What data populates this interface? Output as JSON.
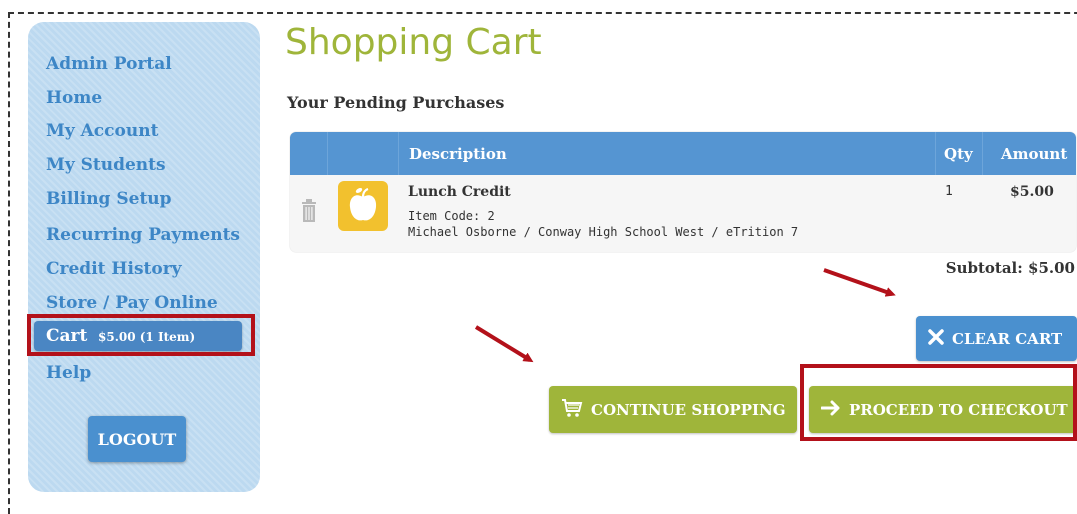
{
  "sidebar": {
    "items": [
      {
        "label": "Admin Portal"
      },
      {
        "label": "Home"
      },
      {
        "label": "My Account"
      },
      {
        "label": "My Students"
      },
      {
        "label": "Billing Setup"
      },
      {
        "label": "Recurring Payments"
      },
      {
        "label": "Credit History"
      },
      {
        "label": "Store / Pay Online"
      },
      {
        "label": "Cart",
        "badge": "$5.00 (1 Item)",
        "active": true
      },
      {
        "label": "Help"
      }
    ],
    "logout_label": "LOGOUT"
  },
  "main": {
    "title": "Shopping Cart",
    "subtitle": "Your Pending Purchases",
    "table": {
      "headers": {
        "description": "Description",
        "qty": "Qty",
        "amount": "Amount"
      },
      "rows": [
        {
          "name": "Lunch Credit",
          "item_code": "Item Code: 2",
          "detail": "Michael Osborne / Conway High School West / eTrition 7",
          "qty": "1",
          "amount": "$5.00",
          "icon": "apple-icon"
        }
      ]
    },
    "subtotal": "Subtotal: $5.00",
    "buttons": {
      "clear_cart": "CLEAR CART",
      "continue_shopping": "CONTINUE SHOPPING",
      "proceed_checkout": "PROCEED TO CHECKOUT"
    }
  },
  "colors": {
    "sidebar_bg": "#bcd9f0",
    "nav_link": "#3d86c6",
    "title_green": "#9fb53a",
    "header_blue": "#5595d2",
    "button_blue": "#4a90cf",
    "button_green": "#9fb53a",
    "highlight_red": "#b3111a",
    "arrow_red": "#b3111a"
  }
}
